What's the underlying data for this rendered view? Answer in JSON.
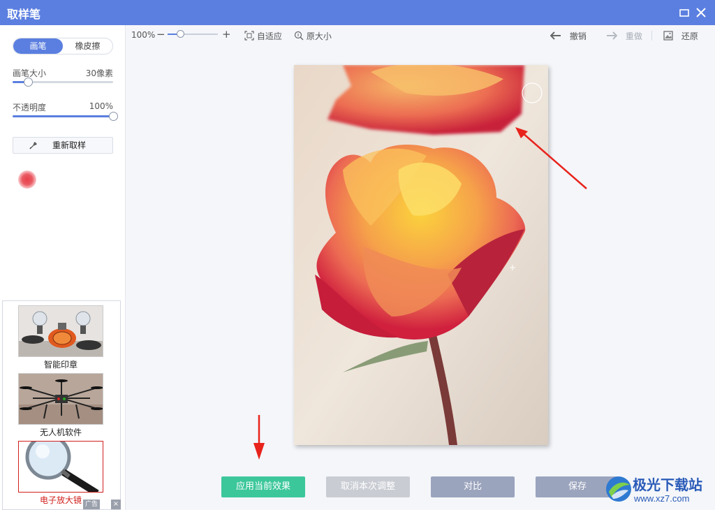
{
  "window": {
    "title": "取样笔"
  },
  "left": {
    "mode_brush": "画笔",
    "mode_eraser": "橡皮擦",
    "brush_size": {
      "label": "画笔大小",
      "value": "30像素",
      "fraction": 0.15
    },
    "opacity": {
      "label": "不透明度",
      "value": "100%",
      "fraction": 1.0
    },
    "resample_label": "重新取样",
    "sample_color": "#e8404a"
  },
  "ads": {
    "items": [
      {
        "caption": "智能印章"
      },
      {
        "caption": "无人机软件"
      },
      {
        "caption": "电子放大镜"
      }
    ],
    "tag": "广告",
    "close": "×"
  },
  "toolbar": {
    "zoom": "100%",
    "zoom_minus": "−",
    "zoom_plus": "+",
    "zoom_fraction": 0.25,
    "fit": "自适应",
    "original": "原大小",
    "undo": "撤销",
    "redo": "重做",
    "restore": "还原"
  },
  "actions": {
    "apply": "应用当前效果",
    "cancel": "取消本次调整",
    "compare": "对比",
    "save": "保存"
  },
  "watermark": {
    "title": "极光下载站",
    "url": "www.xz7.com"
  },
  "colors": {
    "accent": "#5b7fe0",
    "apply": "#3cc79b",
    "arrow": "#e8231c"
  }
}
